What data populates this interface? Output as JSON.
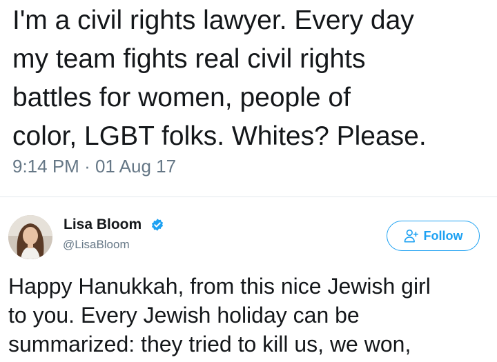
{
  "main_tweet": {
    "text": "I'm a civil rights lawyer. Every day\nmy team fights real civil rights\nbattles for women, people of\ncolor, LGBT folks. Whites? Please.",
    "time": "9:14 PM",
    "separator": "·",
    "date": "01 Aug 17"
  },
  "embedded_tweet": {
    "author": {
      "name": "Lisa Bloom",
      "handle": "@LisaBloom",
      "verified": true
    },
    "follow_label": "Follow",
    "text": "Happy Hanukkah, from this nice Jewish girl\nto you. Every Jewish holiday can be\nsummarized: they tried to kill us, we won,"
  },
  "colors": {
    "text": "#14171a",
    "muted": "#657786",
    "accent": "#1da1f2",
    "divider": "#e1e8ed"
  },
  "icons": {
    "verified": "verified-badge-icon",
    "follow": "add-person-icon"
  }
}
